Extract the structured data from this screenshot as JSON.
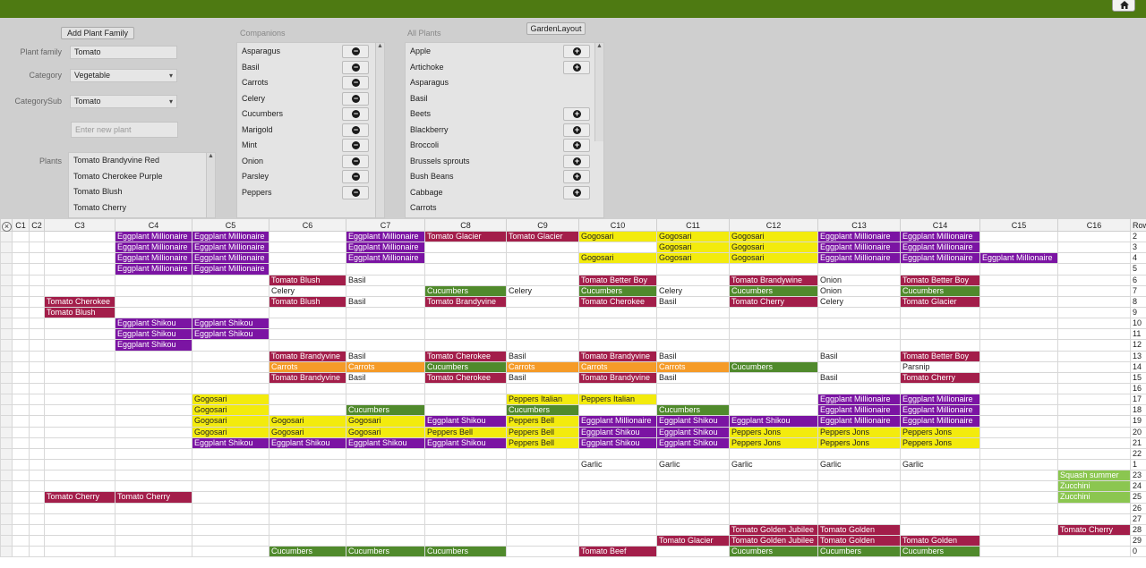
{
  "app": {
    "layout_button": "GardenLayout",
    "add_family_button": "Add Plant Family",
    "colors": {
      "purple": "#7b14a3",
      "red": "#a31e4a",
      "yellow": "#f3eb0d",
      "green": "#508a2c",
      "orange": "#f59b28",
      "lightgreen": "#8bc650",
      "topbar": "#4e7a12"
    }
  },
  "form": {
    "plant_family_label": "Plant family",
    "plant_family_value": "Tomato",
    "category_label": "Category",
    "category_value": "Vegetable",
    "categorysub_label": "CategorySub",
    "categorysub_value": "Tomato",
    "new_plant_placeholder": "Enter new plant",
    "plants_label": "Plants",
    "plants": [
      "Tomato Brandyvine Red",
      "Tomato Cherokee Purple",
      "Tomato Blush",
      "Tomato Cherry"
    ]
  },
  "companions": {
    "header": "Companions",
    "items": [
      "Asparagus",
      "Basil",
      "Carrots",
      "Celery",
      "Cucumbers",
      "Marigold",
      "Mint",
      "Onion",
      "Parsley",
      "Peppers"
    ]
  },
  "all_plants": {
    "header": "All Plants",
    "items": [
      {
        "name": "Apple",
        "add": true
      },
      {
        "name": "Artichoke",
        "add": true
      },
      {
        "name": "Asparagus",
        "add": false
      },
      {
        "name": "Basil",
        "add": false
      },
      {
        "name": "Beets",
        "add": true
      },
      {
        "name": "Blackberry",
        "add": true
      },
      {
        "name": "Broccoli",
        "add": true
      },
      {
        "name": "Brussels sprouts",
        "add": true
      },
      {
        "name": "Bush Beans",
        "add": true
      },
      {
        "name": "Cabbage",
        "add": true
      },
      {
        "name": "Carrots",
        "add": false
      }
    ]
  },
  "grid": {
    "columns": [
      "C1",
      "C2",
      "C3",
      "C4",
      "C5",
      "C6",
      "C7",
      "C8",
      "C9",
      "C10",
      "C11",
      "C12",
      "C13",
      "C14",
      "C15",
      "C16",
      "Row"
    ],
    "rows": [
      {
        "row": "2",
        "cells": {
          "C4": [
            "Eggplant Millionaire",
            "purple"
          ],
          "C5": [
            "Eggplant Millionaire",
            "purple"
          ],
          "C7": [
            "Eggplant Millionaire",
            "purple"
          ],
          "C8": [
            "Tomato Glacier",
            "red"
          ],
          "C9": [
            "Tomato Glacier",
            "red"
          ],
          "C10": [
            "Gogosari",
            "yellow"
          ],
          "C11": [
            "Gogosari",
            "yellow"
          ],
          "C12": [
            "Gogosari",
            "yellow"
          ],
          "C13": [
            "Eggplant Millionaire",
            "purple"
          ],
          "C14": [
            "Eggplant Millionaire",
            "purple"
          ]
        }
      },
      {
        "row": "3",
        "cells": {
          "C4": [
            "Eggplant Millionaire",
            "purple"
          ],
          "C5": [
            "Eggplant Millionaire",
            "purple"
          ],
          "C7": [
            "Eggplant Millionaire",
            "purple"
          ],
          "C11": [
            "Gogosari",
            "yellow"
          ],
          "C12": [
            "Gogosari",
            "yellow"
          ],
          "C13": [
            "Eggplant Millionaire",
            "purple"
          ],
          "C14": [
            "Eggplant Millionaire",
            "purple"
          ]
        }
      },
      {
        "row": "4",
        "cells": {
          "C4": [
            "Eggplant Millionaire",
            "purple"
          ],
          "C5": [
            "Eggplant Millionaire",
            "purple"
          ],
          "C7": [
            "Eggplant Millionaire",
            "purple"
          ],
          "C10": [
            "Gogosari",
            "yellow"
          ],
          "C11": [
            "Gogosari",
            "yellow"
          ],
          "C12": [
            "Gogosari",
            "yellow"
          ],
          "C13": [
            "Eggplant Millionaire",
            "purple"
          ],
          "C14": [
            "Eggplant Millionaire",
            "purple"
          ],
          "C15": [
            "Eggplant Millionaire",
            "purple"
          ]
        }
      },
      {
        "row": "5",
        "cells": {
          "C4": [
            "Eggplant Millionaire",
            "purple"
          ],
          "C5": [
            "Eggplant Millionaire",
            "purple"
          ]
        }
      },
      {
        "row": "6",
        "cells": {
          "C6": [
            "Tomato Blush",
            "red"
          ],
          "C7": [
            "Basil",
            "white"
          ],
          "C10": [
            "Tomato Better Boy",
            "red"
          ],
          "C12": [
            "Tomato Brandywine",
            "red"
          ],
          "C13": [
            "Onion",
            "white"
          ],
          "C14": [
            "Tomato Better Boy",
            "red"
          ]
        }
      },
      {
        "row": "7",
        "cells": {
          "C6": [
            "Celery",
            "white"
          ],
          "C8": [
            "Cucumbers",
            "green"
          ],
          "C9": [
            "Celery",
            "white"
          ],
          "C10": [
            "Cucumbers",
            "green"
          ],
          "C11": [
            "Celery",
            "white"
          ],
          "C12": [
            "Cucumbers",
            "green"
          ],
          "C13": [
            "Onion",
            "white"
          ],
          "C14": [
            "Cucumbers",
            "green"
          ]
        }
      },
      {
        "row": "8",
        "cells": {
          "C3": [
            "Tomato Cherokee",
            "red"
          ],
          "C6": [
            "Tomato Blush",
            "red"
          ],
          "C7": [
            "Basil",
            "white"
          ],
          "C8": [
            "Tomato Brandyvine",
            "red"
          ],
          "C10": [
            "Tomato Cherokee",
            "red"
          ],
          "C11": [
            "Basil",
            "white"
          ],
          "C12": [
            "Tomato Cherry",
            "red"
          ],
          "C13": [
            "Celery",
            "white"
          ],
          "C14": [
            "Tomato Glacier",
            "red"
          ]
        }
      },
      {
        "row": "9",
        "cells": {
          "C3": [
            "Tomato Blush",
            "red"
          ]
        }
      },
      {
        "row": "10",
        "cells": {
          "C4": [
            "Eggplant Shikou",
            "purple"
          ],
          "C5": [
            "Eggplant Shikou",
            "purple"
          ]
        }
      },
      {
        "row": "11",
        "cells": {
          "C4": [
            "Eggplant Shikou",
            "purple"
          ],
          "C5": [
            "Eggplant Shikou",
            "purple"
          ]
        }
      },
      {
        "row": "12",
        "cells": {
          "C4": [
            "Eggplant Shikou",
            "purple"
          ]
        }
      },
      {
        "row": "13",
        "cells": {
          "C6": [
            "Tomato Brandyvine",
            "red"
          ],
          "C7": [
            "Basil",
            "white"
          ],
          "C8": [
            "Tomato Cherokee",
            "red"
          ],
          "C9": [
            "Basil",
            "white"
          ],
          "C10": [
            "Tomato Brandyvine",
            "red"
          ],
          "C11": [
            "Basil",
            "white"
          ],
          "C13": [
            "Basil",
            "white"
          ],
          "C14": [
            "Tomato Better Boy",
            "red"
          ]
        }
      },
      {
        "row": "14",
        "cells": {
          "C6": [
            "Carrots",
            "orange"
          ],
          "C7": [
            "Carrots",
            "orange"
          ],
          "C8": [
            "Cucumbers",
            "green"
          ],
          "C9": [
            "Carrots",
            "orange"
          ],
          "C10": [
            "Carrots",
            "orange"
          ],
          "C11": [
            "Carrots",
            "orange"
          ],
          "C12": [
            "Cucumbers",
            "green"
          ],
          "C14": [
            "Parsnip",
            "white"
          ]
        }
      },
      {
        "row": "15",
        "cells": {
          "C6": [
            "Tomato Brandyvine",
            "red"
          ],
          "C7": [
            "Basil",
            "white"
          ],
          "C8": [
            "Tomato Cherokee",
            "red"
          ],
          "C9": [
            "Basil",
            "white"
          ],
          "C10": [
            "Tomato Brandyvine",
            "red"
          ],
          "C11": [
            "Basil",
            "white"
          ],
          "C13": [
            "Basil",
            "white"
          ],
          "C14": [
            "Tomato Cherry",
            "red"
          ]
        }
      },
      {
        "row": "16",
        "cells": {}
      },
      {
        "row": "17",
        "cells": {
          "C5": [
            "Gogosari",
            "yellow"
          ],
          "C9": [
            "Peppers Italian",
            "yellow"
          ],
          "C10": [
            "Peppers Italian",
            "yellow"
          ],
          "C13": [
            "Eggplant Millionaire",
            "purple"
          ],
          "C14": [
            "Eggplant Millionaire",
            "purple"
          ]
        }
      },
      {
        "row": "18",
        "cells": {
          "C5": [
            "Gogosari",
            "yellow"
          ],
          "C7": [
            "Cucumbers",
            "green"
          ],
          "C9": [
            "Cucumbers",
            "green"
          ],
          "C11": [
            "Cucumbers",
            "green"
          ],
          "C13": [
            "Eggplant Millionaire",
            "purple"
          ],
          "C14": [
            "Eggplant Millionaire",
            "purple"
          ]
        }
      },
      {
        "row": "19",
        "cells": {
          "C5": [
            "Gogosari",
            "yellow"
          ],
          "C6": [
            "Gogosari",
            "yellow"
          ],
          "C7": [
            "Gogosari",
            "yellow"
          ],
          "C8": [
            "Eggplant Shikou",
            "purple"
          ],
          "C9": [
            "Peppers Bell",
            "yellow"
          ],
          "C10": [
            "Eggplant Millionaire",
            "purple"
          ],
          "C11": [
            "Eggplant Shikou",
            "purple"
          ],
          "C12": [
            "Eggplant Shikou",
            "purple"
          ],
          "C13": [
            "Eggplant Millionaire",
            "purple"
          ],
          "C14": [
            "Eggplant Millionaire",
            "purple"
          ]
        }
      },
      {
        "row": "20",
        "cells": {
          "C5": [
            "Gogosari",
            "yellow"
          ],
          "C6": [
            "Gogosari",
            "yellow"
          ],
          "C7": [
            "Gogosari",
            "yellow"
          ],
          "C8": [
            "Peppers Bell",
            "yellow"
          ],
          "C9": [
            "Peppers Bell",
            "yellow"
          ],
          "C10": [
            "Eggplant Shikou",
            "purple"
          ],
          "C11": [
            "Eggplant Shikou",
            "purple"
          ],
          "C12": [
            "Peppers Jons",
            "yellow"
          ],
          "C13": [
            "Peppers Jons",
            "yellow"
          ],
          "C14": [
            "Peppers Jons",
            "yellow"
          ]
        }
      },
      {
        "row": "21",
        "cells": {
          "C5": [
            "Eggplant Shikou",
            "purple"
          ],
          "C6": [
            "Eggplant Shikou",
            "purple"
          ],
          "C7": [
            "Eggplant Shikou",
            "purple"
          ],
          "C8": [
            "Eggplant Shikou",
            "purple"
          ],
          "C9": [
            "Peppers Bell",
            "yellow"
          ],
          "C10": [
            "Eggplant Shikou",
            "purple"
          ],
          "C11": [
            "Eggplant Shikou",
            "purple"
          ],
          "C12": [
            "Peppers Jons",
            "yellow"
          ],
          "C13": [
            "Peppers Jons",
            "yellow"
          ],
          "C14": [
            "Peppers Jons",
            "yellow"
          ]
        }
      },
      {
        "row": "22",
        "cells": {}
      },
      {
        "row": "1",
        "cells": {
          "C10": [
            "Garlic",
            "white"
          ],
          "C11": [
            "Garlic",
            "white"
          ],
          "C12": [
            "Garlic",
            "white"
          ],
          "C13": [
            "Garlic",
            "white"
          ],
          "C14": [
            "Garlic",
            "white"
          ]
        }
      },
      {
        "row": "23",
        "cells": {
          "C16": [
            "Squash summer",
            "lightgreen"
          ]
        }
      },
      {
        "row": "24",
        "cells": {
          "C16": [
            "Zucchini",
            "lightgreen"
          ]
        }
      },
      {
        "row": "25",
        "cells": {
          "C3": [
            "Tomato Cherry",
            "red"
          ],
          "C4": [
            "Tomato Cherry",
            "red"
          ],
          "C16": [
            "Zucchini",
            "lightgreen"
          ]
        }
      },
      {
        "row": "26",
        "cells": {}
      },
      {
        "row": "27",
        "cells": {}
      },
      {
        "row": "28",
        "cells": {
          "C12": [
            "Tomato Golden Jubilee",
            "red"
          ],
          "C13": [
            "Tomato Golden",
            "red"
          ],
          "C16": [
            "Tomato Cherry",
            "red"
          ]
        }
      },
      {
        "row": "29",
        "cells": {
          "C11": [
            "Tomato Glacier",
            "red"
          ],
          "C12": [
            "Tomato Golden Jubilee",
            "red"
          ],
          "C13": [
            "Tomato Golden",
            "red"
          ],
          "C14": [
            "Tomato Golden",
            "red"
          ]
        }
      },
      {
        "row": "0",
        "cells": {
          "C6": [
            "Cucumbers",
            "green"
          ],
          "C7": [
            "Cucumbers",
            "green"
          ],
          "C8": [
            "Cucumbers",
            "green"
          ],
          "C10": [
            "Tomato Beef",
            "red"
          ],
          "C12": [
            "Cucumbers",
            "green"
          ],
          "C13": [
            "Cucumbers",
            "green"
          ],
          "C14": [
            "Cucumbers",
            "green"
          ]
        }
      }
    ]
  }
}
